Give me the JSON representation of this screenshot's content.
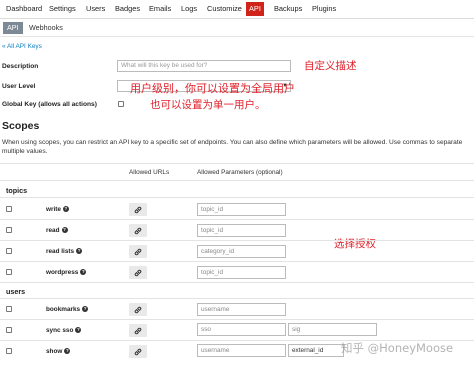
{
  "nav": {
    "tabs": [
      "Dashboard",
      "Settings",
      "Users",
      "Badges",
      "Emails",
      "Logs",
      "Customize",
      "API",
      "Backups",
      "Plugins"
    ],
    "active_tab": "API"
  },
  "subnav": {
    "tabs": [
      "API",
      "Webhooks"
    ],
    "active_tab": "API"
  },
  "back_link": "« All API Keys",
  "form": {
    "description_label": "Description",
    "description_placeholder": "What will this key be used for?",
    "user_level_label": "User Level",
    "user_level_value": "",
    "global_key_label": "Global Key (allows all actions)",
    "global_key_checked": false
  },
  "annotations": {
    "description": "自定义描述",
    "user_level": "用户级别，你可以设置为全局用户",
    "single_user": "也可以设置为单一用户。",
    "authorize": "选择授权"
  },
  "scopes": {
    "title": "Scopes",
    "help": "When using scopes, you can restrict an API key to a specific set of endpoints. You can also define which parameters will be allowed. Use commas to separate multiple values.",
    "col_urls": "Allowed URLs",
    "col_params": "Allowed Parameters (optional)",
    "groups": [
      {
        "name": "topics",
        "rows": [
          {
            "label": "write",
            "params": [
              "topic_id"
            ]
          },
          {
            "label": "read",
            "params": [
              "topic_id"
            ]
          },
          {
            "label": "read lists",
            "params": [
              "category_id"
            ]
          },
          {
            "label": "wordpress",
            "params": [
              "topic_id"
            ]
          }
        ]
      },
      {
        "name": "users",
        "rows": [
          {
            "label": "bookmarks",
            "params": [
              "username"
            ]
          },
          {
            "label": "sync sso",
            "params": [
              "sso",
              "sig"
            ]
          },
          {
            "label": "show",
            "params": [
              "username",
              "external_id"
            ]
          }
        ]
      }
    ]
  },
  "icons": {
    "info": "info-circle-icon",
    "link": "link-icon"
  },
  "colors": {
    "accent": "#d0241b",
    "subnav_active": "#7d8a96",
    "link": "#0a7fc0",
    "annotation": "#e0202a"
  },
  "watermark": "知乎 @HoneyMoose"
}
